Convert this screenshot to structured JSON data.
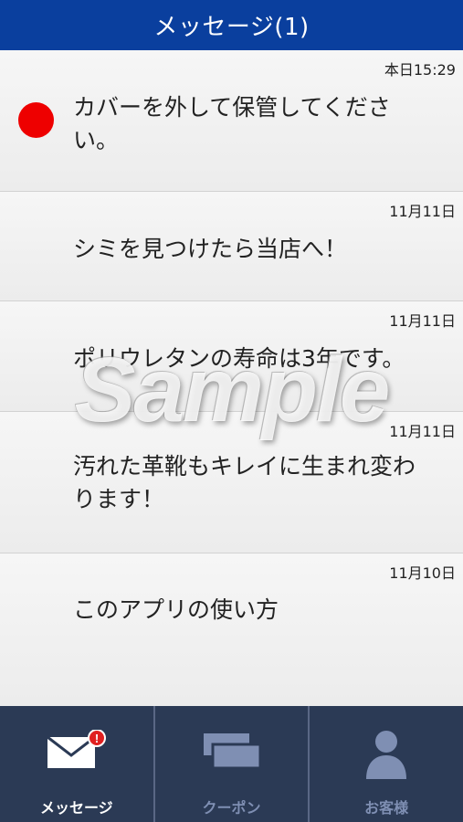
{
  "header": {
    "title": "メッセージ(1)"
  },
  "messages": [
    {
      "date": "本日15:29",
      "title": "カバーを外して保管してください。",
      "unread": true
    },
    {
      "date": "11月11日",
      "title": "シミを見つけたら当店へ！",
      "unread": false
    },
    {
      "date": "11月11日",
      "title": "ポリウレタンの寿命は3年です。",
      "unread": false
    },
    {
      "date": "11月11日",
      "title": "汚れた革靴もキレイに生まれ変わります！",
      "unread": false
    },
    {
      "date": "11月10日",
      "title": "このアプリの使い方",
      "unread": false
    }
  ],
  "watermark": "Sample",
  "tabs": [
    {
      "label": "メッセージ",
      "icon": "envelope-icon",
      "active": true,
      "badge": "!"
    },
    {
      "label": "クーポン",
      "icon": "coupon-icon",
      "active": false
    },
    {
      "label": "お客様",
      "icon": "person-icon",
      "active": false
    }
  ],
  "colors": {
    "header": "#0a3f9e",
    "unread": "#ee0000",
    "tabbar": "#2b3a55",
    "tab_inactive": "#7f8fb3"
  }
}
